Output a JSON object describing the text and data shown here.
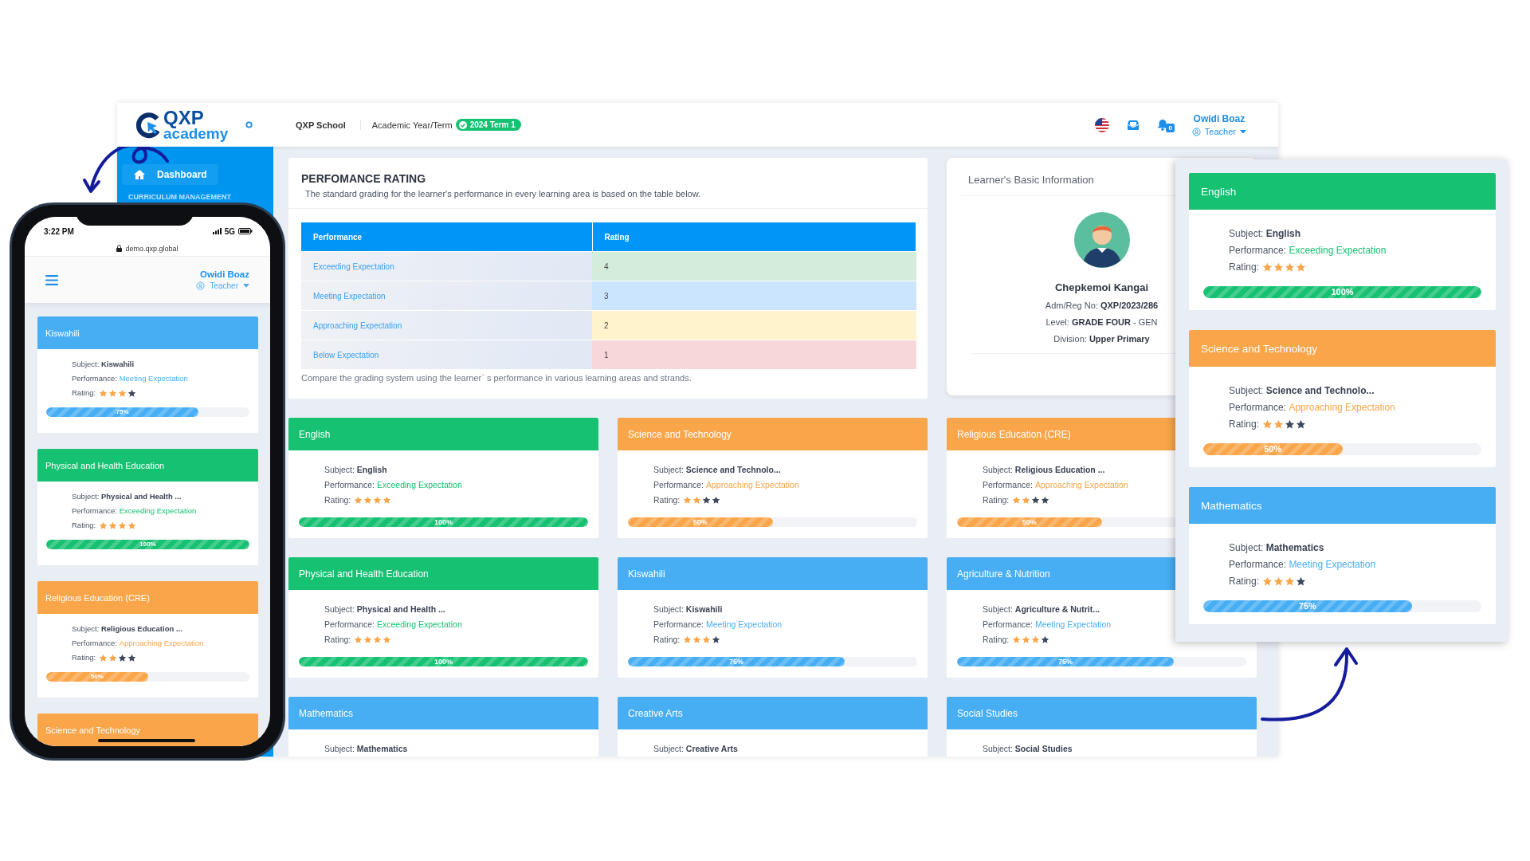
{
  "header": {
    "logo": {
      "top": "QXP",
      "bottom": "academy"
    },
    "school": "QXP School",
    "term_label": "Academic Year/Term",
    "term": "2024 Term 1",
    "notifications": "0",
    "user": {
      "name": "Owidi Boaz",
      "role": "Teacher"
    }
  },
  "sidebar": {
    "items": [
      {
        "label": "Dashboard",
        "selected": true
      }
    ],
    "section": "CURRICULUM MANAGEMENT"
  },
  "rating_card": {
    "title": "PERFOMANCE RATING",
    "subtitle": "The standard grading for the learner's performance in every learning area is based on the table below.",
    "columns": [
      "Performance",
      "Rating"
    ],
    "rows": [
      {
        "performance": "Exceeding Expectation",
        "rating": "4",
        "color": "#d4edda"
      },
      {
        "performance": "Meeting Expectation",
        "rating": "3",
        "color": "#cce5ff"
      },
      {
        "performance": "Approaching Expectation",
        "rating": "2",
        "color": "#fff3cd"
      },
      {
        "performance": "Below Expectation",
        "rating": "1",
        "color": "#f8d7da"
      }
    ],
    "note": "Compare the grading system using the learner` s performance in various learning areas and strands."
  },
  "learner": {
    "title": "Learner's Basic Information",
    "name": "Chepkemoi Kangai",
    "lines": [
      "Adm/Reg No: **QXP/2023/286**",
      "Level: **GRADE FOUR** - GEN",
      "Division: **Upper Primary**"
    ]
  },
  "subjects": [
    {
      "title": "English",
      "color": "#16c172",
      "subject": "Subject: **English**",
      "performance_label": "Performance:",
      "performance": "Exceeding Expectation",
      "rating_label": "Rating:",
      "stars": 4,
      "level": 1,
      "percent": "100%"
    },
    {
      "title": "Science and Technology",
      "color": "#f9a54a",
      "subject": "Subject: **Science and Technolo...**",
      "performance_label": "Performance:",
      "performance": "Approaching Expectation",
      "rating_label": "Rating:",
      "stars": 2,
      "level": 0.5,
      "percent": "50%"
    },
    {
      "title": "Religious Education (CRE)",
      "color": "#f9a54a",
      "subject": "Subject: **Religious Education ...**",
      "performance_label": "Performance:",
      "performance": "Approaching Expectation",
      "rating_label": "Rating:",
      "stars": 2,
      "level": 0.5,
      "percent": "50%"
    },
    {
      "title": "Physical and Health Education",
      "color": "#16c172",
      "subject": "Subject: **Physical and Health ...**",
      "performance_label": "Performance:",
      "performance": "Exceeding Expectation",
      "rating_label": "Rating:",
      "stars": 4,
      "level": 1,
      "percent": "100%"
    },
    {
      "title": "Kiswahili",
      "color": "#47aef4",
      "subject": "Subject: **Kiswahili**",
      "performance_label": "Performance:",
      "performance": "Meeting Expectation",
      "rating_label": "Rating:",
      "stars": 3,
      "level": 0.75,
      "percent": "75%"
    },
    {
      "title": "Agriculture & Nutrition",
      "color": "#47aef4",
      "subject": "Subject: **Agriculture & Nutrit...**",
      "performance_label": "Performance:",
      "performance": "Meeting Expectation",
      "rating_label": "Rating:",
      "stars": 3,
      "level": 0.75,
      "percent": "75%"
    },
    {
      "title": "Mathematics",
      "color": "#47aef4",
      "subject": "Subject: **Mathematics**"
    },
    {
      "title": "Creative Arts",
      "color": "#47aef4",
      "subject": "Subject: **Creative Arts**"
    },
    {
      "title": "Social Studies",
      "color": "#47aef4",
      "subject": "Subject: **Social Studies**"
    }
  ],
  "phone": {
    "time": "3:22 PM",
    "network": "5G",
    "url": "demo.qxp.global",
    "user": {
      "name": "Owidi Boaz",
      "role": "Teacher"
    },
    "subjects": [
      {
        "title": "Kiswahili",
        "color": "#47aef4",
        "subject": "Subject: **Kiswahili**",
        "performance_label": "Performance:",
        "performance": "Meeting Expectation",
        "rating_label": "Rating:",
        "stars": 3,
        "level": 0.75,
        "percent": "75%"
      },
      {
        "title": "Physical and Health Education",
        "color": "#16c172",
        "subject": "Subject: **Physical and Health ...**",
        "performance_label": "Performance:",
        "performance": "Exceeding Expectation",
        "rating_label": "Rating:",
        "stars": 4,
        "level": 1,
        "percent": "100%"
      },
      {
        "title": "Religious Education (CRE)",
        "color": "#f9a54a",
        "subject": "Subject: **Religious Education ...**",
        "performance_label": "Performance:",
        "performance": "Approaching Expectation",
        "rating_label": "Rating:",
        "stars": 2,
        "level": 0.5,
        "percent": "50%"
      },
      {
        "title": "Science and Technology",
        "color": "#f9a54a"
      }
    ]
  },
  "zoom_panel": {
    "subjects": [
      {
        "title": "English",
        "color": "#16c172",
        "subject": "Subject: **English**",
        "performance_label": "Performance:",
        "performance": "Exceeding Expectation",
        "rating_label": "Rating:",
        "stars": 4,
        "level": 1,
        "percent": "100%"
      },
      {
        "title": "Science and Technology",
        "color": "#f9a54a",
        "subject": "Subject: **Science and Technolo...**",
        "performance_label": "Performance:",
        "performance": "Approaching Expectation",
        "rating_label": "Rating:",
        "stars": 2,
        "level": 0.5,
        "percent": "50%"
      },
      {
        "title": "Mathematics",
        "color": "#47aef4",
        "subject": "Subject: **Mathematics**",
        "performance_label": "Performance:",
        "performance": "Meeting Expectation",
        "rating_label": "Rating:",
        "stars": 3,
        "level": 0.75,
        "percent": "75%"
      }
    ]
  }
}
